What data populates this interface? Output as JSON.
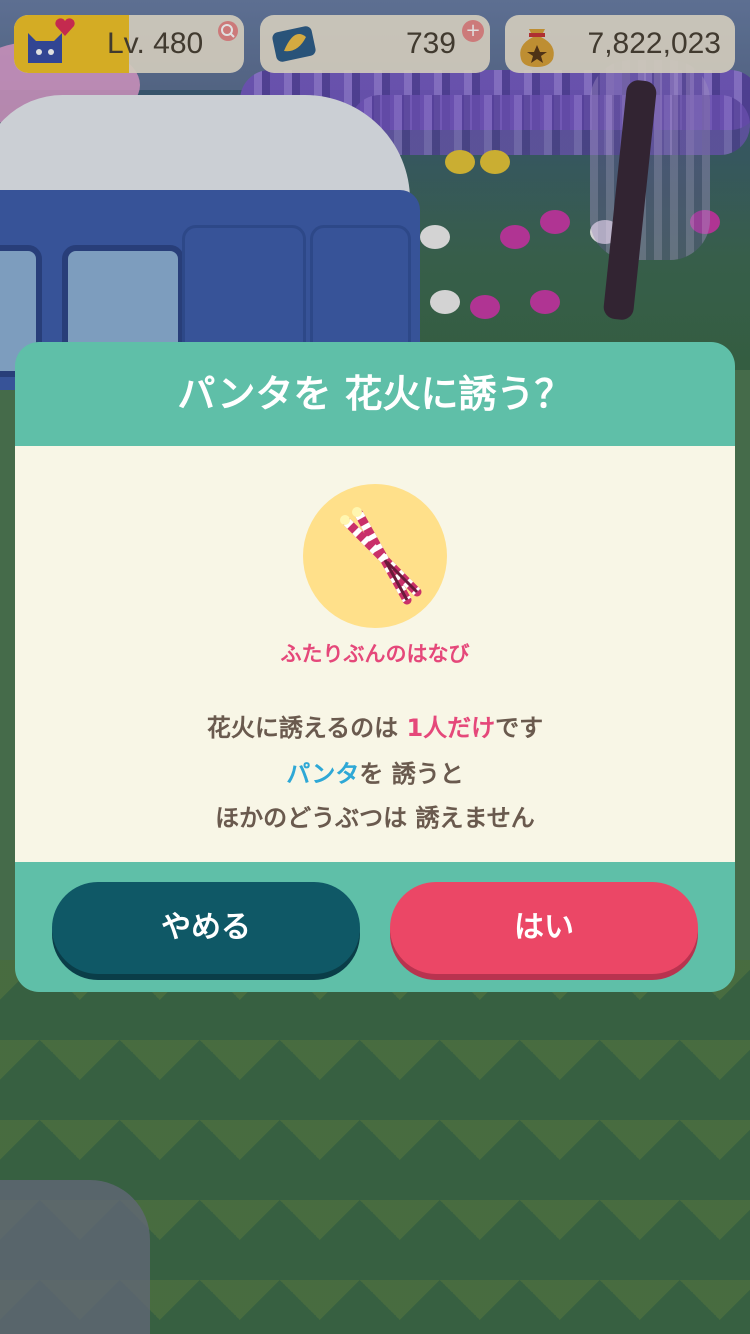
{
  "hud": {
    "level_label": "Lv. 480",
    "tickets": "739",
    "bells": "7,822,023",
    "level_progress": 0.5
  },
  "dialog": {
    "title": "パンタを 花火に誘う？",
    "item_name": "ふたりぶんのはなび",
    "line1_prefix": "花火に誘えるのは ",
    "line1_highlight": "1人だけ",
    "line1_suffix": "です",
    "line2_name": "パンタ",
    "line2_suffix": "を 誘うと",
    "line3": "ほかのどうぶつは 誘えません",
    "cancel_label": "やめる",
    "confirm_label": "はい"
  },
  "colors": {
    "modal_accent": "#5fbfa8",
    "cancel_button": "#0f5866",
    "confirm_button": "#eb4766",
    "highlight_pink": "#e5487a",
    "highlight_blue": "#2ea8d6"
  },
  "icons": {
    "avatar": "cat-face-icon",
    "heart": "heart-icon",
    "level_add": "magnifier-plus-icon",
    "tickets": "leaf-ticket-icon",
    "tickets_add": "plus-icon",
    "bells": "bell-bag-icon",
    "item": "sparkler-icon"
  }
}
